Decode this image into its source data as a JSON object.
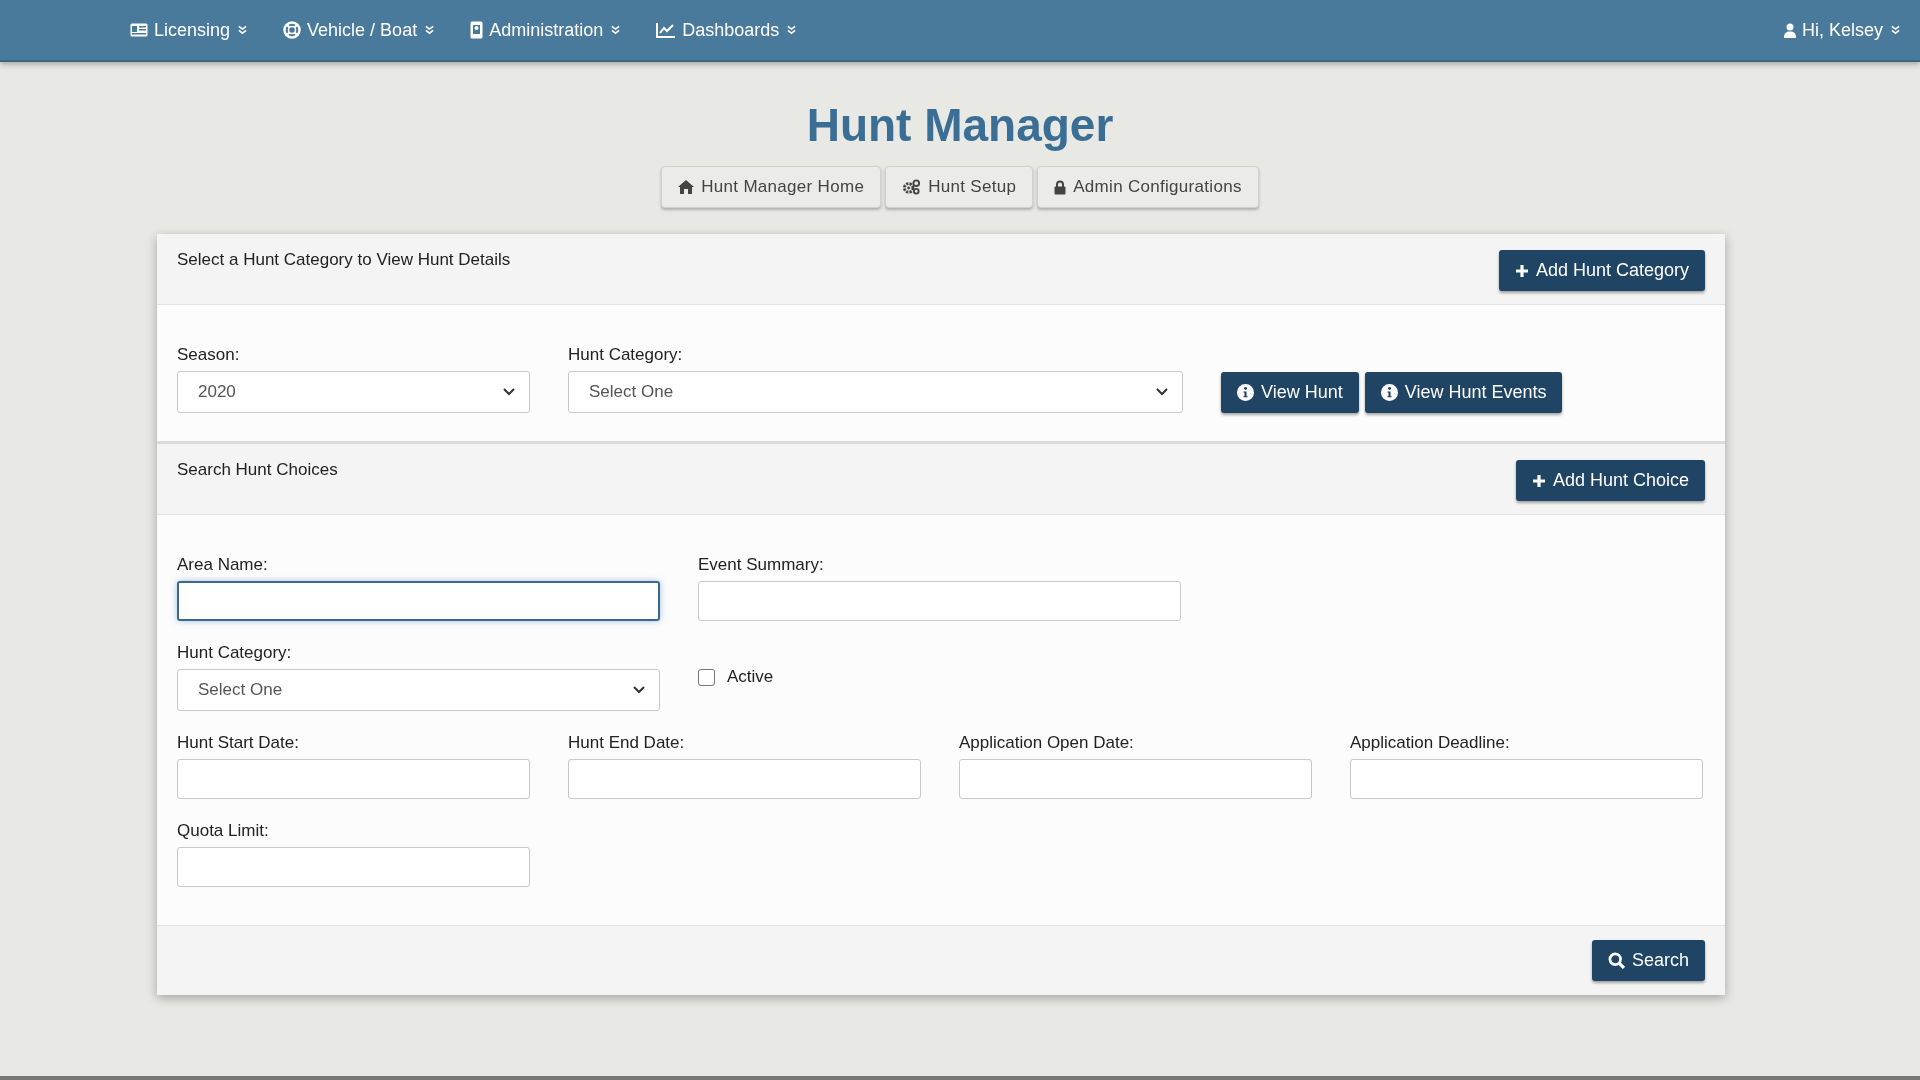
{
  "nav": {
    "menus": [
      {
        "label": "Licensing"
      },
      {
        "label": "Vehicle / Boat"
      },
      {
        "label": "Administration"
      },
      {
        "label": "Dashboards"
      }
    ],
    "user": "Hi, Kelsey"
  },
  "title": "Hunt Manager",
  "tabs": [
    {
      "label": "Hunt Manager Home"
    },
    {
      "label": "Hunt Setup"
    },
    {
      "label": "Admin Configurations"
    }
  ],
  "category_section": {
    "header": "Select a Hunt Category to View Hunt Details",
    "add_button": "Add Hunt Category",
    "fields": [
      {
        "kind": "select",
        "label": "Season:",
        "value": "2020"
      },
      {
        "kind": "select",
        "label": "Hunt Category:",
        "value": "Select One"
      }
    ],
    "buttons": [
      "View Hunt",
      "View Hunt Events"
    ]
  },
  "choice_section": {
    "header": "Search Hunt Choices",
    "add_button": "Add Hunt Choice",
    "rows": [
      [
        {
          "kind": "text",
          "label": "Area Name:",
          "focused": true
        },
        {
          "kind": "text",
          "label": "Event Summary:",
          "focused": false
        }
      ],
      [
        {
          "kind": "select",
          "label": "Hunt Category:",
          "value": "Select One"
        },
        {
          "kind": "checkbox",
          "label": "Active",
          "checked": false
        }
      ],
      [
        {
          "kind": "text",
          "label": "Hunt Start Date:",
          "focused": false
        },
        {
          "kind": "text",
          "label": "Hunt End Date:",
          "focused": false
        },
        {
          "kind": "text",
          "label": "Application Open Date:",
          "focused": false
        },
        {
          "kind": "text",
          "label": "Application Deadline:",
          "focused": false
        }
      ],
      [
        {
          "kind": "text",
          "label": "Quota Limit:",
          "focused": false
        }
      ]
    ]
  },
  "search_button": "Search"
}
